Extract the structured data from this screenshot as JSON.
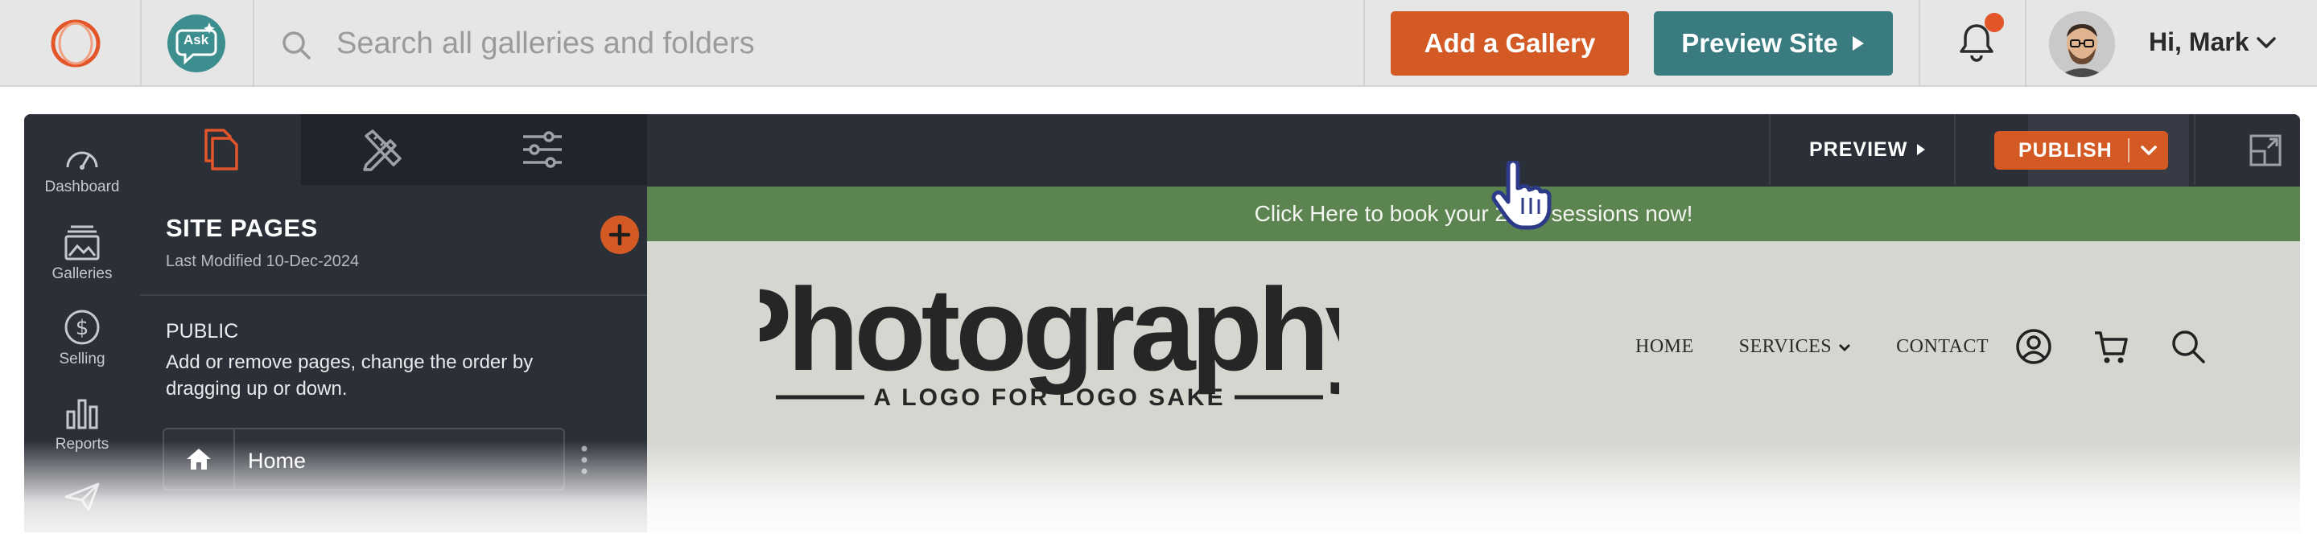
{
  "topbar": {
    "search_placeholder": "Search all galleries and folders",
    "add_gallery_label": "Add a Gallery",
    "preview_site_label": "Preview Site",
    "greeting": "Hi, Mark",
    "ask_label": "Ask"
  },
  "rail": {
    "items": [
      {
        "label": "Dashboard",
        "icon": "gauge-icon"
      },
      {
        "label": "Galleries",
        "icon": "image-stack-icon"
      },
      {
        "label": "Selling",
        "icon": "dollar-circle-icon"
      },
      {
        "label": "Reports",
        "icon": "bar-chart-icon"
      },
      {
        "label": "",
        "icon": "paper-plane-icon"
      }
    ]
  },
  "toolbar": {
    "preview_label": "PREVIEW",
    "publish_label": "PUBLISH"
  },
  "pages_panel": {
    "title": "SITE PAGES",
    "last_modified": "Last Modified 10-Dec-2024",
    "section": "PUBLIC",
    "help_text": "Add or remove pages, change the order by dragging up or down.",
    "pages": [
      {
        "label": "Home"
      }
    ]
  },
  "site": {
    "promo_text": "Click Here to book your 2025 sessions now!",
    "brand_name": "Photography",
    "tagline": "A LOGO FOR LOGO SAKE",
    "nav": [
      {
        "label": "HOME"
      },
      {
        "label": "SERVICES"
      },
      {
        "label": "CONTACT"
      }
    ]
  },
  "colors": {
    "accent_orange": "#d45a25",
    "teal": "#3a7b80",
    "editor_dark": "#2b2f38",
    "promo_green": "#5c8450"
  }
}
